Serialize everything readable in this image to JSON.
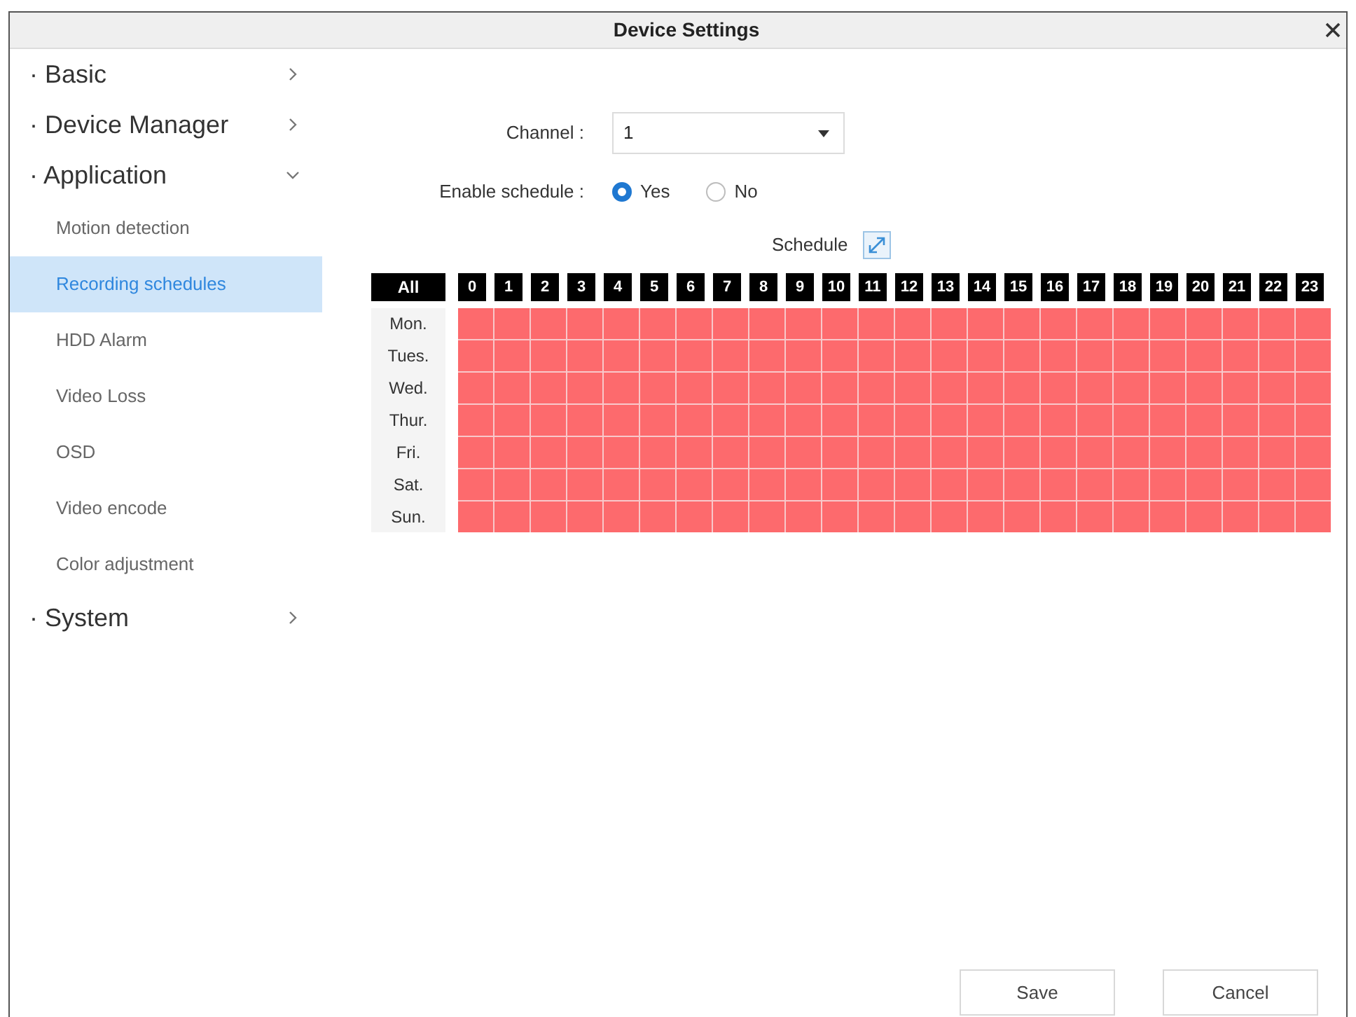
{
  "window": {
    "title": "Device Settings"
  },
  "sidebar": {
    "items": [
      {
        "label": "· Basic",
        "expanded": false
      },
      {
        "label": "· Device Manager",
        "expanded": false
      },
      {
        "label": "· Application",
        "expanded": true,
        "children": [
          {
            "label": "Motion detection",
            "selected": false
          },
          {
            "label": "Recording schedules",
            "selected": true
          },
          {
            "label": "HDD Alarm",
            "selected": false
          },
          {
            "label": "Video Loss",
            "selected": false
          },
          {
            "label": "OSD",
            "selected": false
          },
          {
            "label": "Video encode",
            "selected": false
          },
          {
            "label": "Color adjustment",
            "selected": false
          }
        ]
      },
      {
        "label": "· System",
        "expanded": false
      }
    ]
  },
  "channel": {
    "label": "Channel :",
    "value": "1"
  },
  "enable_schedule": {
    "label": "Enable schedule :",
    "options": [
      {
        "label": "Yes",
        "selected": true
      },
      {
        "label": "No",
        "selected": false
      }
    ]
  },
  "schedule": {
    "label": "Schedule",
    "all_label": "All",
    "hours": [
      "0",
      "1",
      "2",
      "3",
      "4",
      "5",
      "6",
      "7",
      "8",
      "9",
      "10",
      "11",
      "12",
      "13",
      "14",
      "15",
      "16",
      "17",
      "18",
      "19",
      "20",
      "21",
      "22",
      "23"
    ],
    "days": [
      {
        "label": "Mon.",
        "slots": [
          true,
          true,
          true,
          true,
          true,
          true,
          true,
          true,
          true,
          true,
          true,
          true,
          true,
          true,
          true,
          true,
          true,
          true,
          true,
          true,
          true,
          true,
          true,
          true
        ]
      },
      {
        "label": "Tues.",
        "slots": [
          true,
          true,
          true,
          true,
          true,
          true,
          true,
          true,
          true,
          true,
          true,
          true,
          true,
          true,
          true,
          true,
          true,
          true,
          true,
          true,
          true,
          true,
          true,
          true
        ]
      },
      {
        "label": "Wed.",
        "slots": [
          true,
          true,
          true,
          true,
          true,
          true,
          true,
          true,
          true,
          true,
          true,
          true,
          true,
          true,
          true,
          true,
          true,
          true,
          true,
          true,
          true,
          true,
          true,
          true
        ]
      },
      {
        "label": "Thur.",
        "slots": [
          true,
          true,
          true,
          true,
          true,
          true,
          true,
          true,
          true,
          true,
          true,
          true,
          true,
          true,
          true,
          true,
          true,
          true,
          true,
          true,
          true,
          true,
          true,
          true
        ]
      },
      {
        "label": "Fri.",
        "slots": [
          true,
          true,
          true,
          true,
          true,
          true,
          true,
          true,
          true,
          true,
          true,
          true,
          true,
          true,
          true,
          true,
          true,
          true,
          true,
          true,
          true,
          true,
          true,
          true
        ]
      },
      {
        "label": "Sat.",
        "slots": [
          true,
          true,
          true,
          true,
          true,
          true,
          true,
          true,
          true,
          true,
          true,
          true,
          true,
          true,
          true,
          true,
          true,
          true,
          true,
          true,
          true,
          true,
          true,
          true
        ]
      },
      {
        "label": "Sun.",
        "slots": [
          true,
          true,
          true,
          true,
          true,
          true,
          true,
          true,
          true,
          true,
          true,
          true,
          true,
          true,
          true,
          true,
          true,
          true,
          true,
          true,
          true,
          true,
          true,
          true
        ]
      }
    ]
  },
  "buttons": [
    {
      "label": "Save"
    },
    {
      "label": "Cancel"
    }
  ]
}
